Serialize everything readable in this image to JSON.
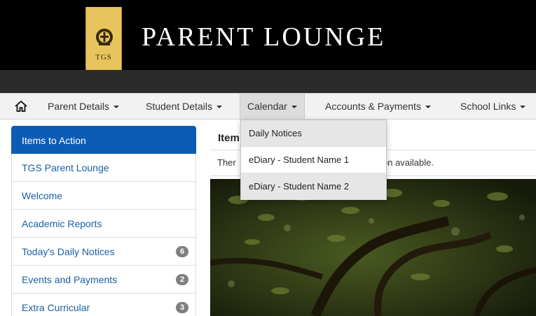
{
  "header": {
    "crest_text": "TGS",
    "site_title": "PARENT LOUNGE"
  },
  "nav": {
    "items": [
      {
        "label": "Parent Details"
      },
      {
        "label": "Student Details"
      },
      {
        "label": "Calendar"
      },
      {
        "label": "Accounts & Payments"
      },
      {
        "label": "School Links"
      }
    ],
    "home_icon": "home-icon",
    "open_menu": "Calendar"
  },
  "dropdown": {
    "items": [
      {
        "label": "Daily Notices"
      },
      {
        "label": "eDiary -  Student Name 1"
      },
      {
        "label": "eDiary -  Student Name 2"
      }
    ]
  },
  "sidebar": {
    "items": [
      {
        "label": "Items to Action",
        "active": true
      },
      {
        "label": "TGS Parent Lounge"
      },
      {
        "label": "Welcome"
      },
      {
        "label": "Academic Reports"
      },
      {
        "label": "Today's Daily Notices",
        "badge": "6"
      },
      {
        "label": "Events and Payments",
        "badge": "2"
      },
      {
        "label": "Extra Curricular",
        "badge": "3"
      }
    ]
  },
  "main": {
    "title_visible": "Item",
    "info_left": "Ther",
    "info_right": "on available."
  },
  "colors": {
    "header_bg": "#000000",
    "crest_gold": "#e8c45c",
    "active_blue": "#0c5bb5",
    "link_blue": "#1a5fa6",
    "badge_gray": "#7f7f7f"
  }
}
